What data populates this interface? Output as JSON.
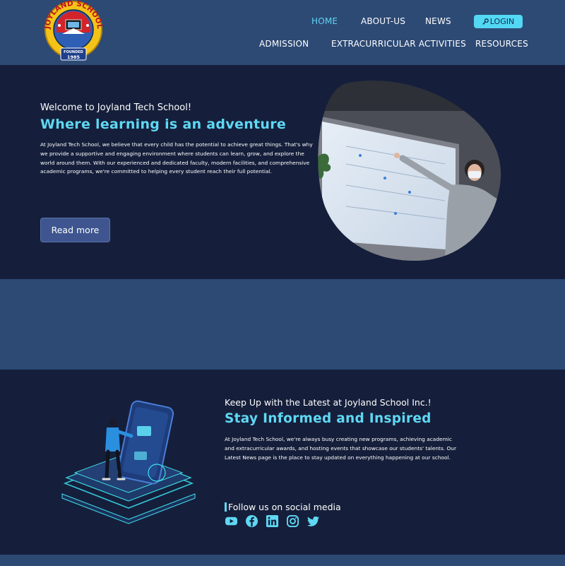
{
  "brand": {
    "logo_top_text": "JOYLAND SCHOOL",
    "logo_ribbon_text": "ENTRANCE PRECEPTORY",
    "logo_founded_label": "FOUNDED",
    "logo_founded_year": "1985"
  },
  "nav": {
    "row1": [
      {
        "label": "HOME",
        "active": true
      },
      {
        "label": "ABOUT-US",
        "active": false
      },
      {
        "label": "NEWS",
        "active": false
      }
    ],
    "login": "LOGIN",
    "row2": [
      {
        "label": "ADMISSION"
      },
      {
        "label": "EXTRACURRICULAR ACTIVITIES"
      },
      {
        "label": "RESOURCES"
      }
    ]
  },
  "hero": {
    "eyebrow": "Welcome to Joyland Tech School!",
    "title": "Where learning is an adventure",
    "body": "At Joyland Tech School, we believe that every child has the potential to achieve great things. That's why we provide a supportive and engaging environment where students can learn, grow, and explore the world around them. With our experienced and dedicated faculty, modern facilities, and comprehensive academic programs, we're committed to helping every student reach their full potential.",
    "button": "Read more"
  },
  "news": {
    "eyebrow": "Keep Up with the Latest at Joyland School Inc.!",
    "title": "Stay Informed and Inspired",
    "body": "At Joyland Tech School, we're always busy creating new programs, achieving academic and extracurricular awards, and hosting events that showcase our students' talents. Our Latest News page is the place to stay updated on everything happening at our school.",
    "follow_label": "Follow us on social media",
    "socials": [
      "youtube-icon",
      "facebook-icon",
      "linkedin-icon",
      "instagram-icon",
      "twitter-icon"
    ]
  },
  "colors": {
    "accent": "#5fd8f3",
    "nav_bg": "#2d4a75",
    "page_bg": "#151f3b",
    "button_bg": "#3e558f",
    "login_bg": "#53d8f4"
  }
}
